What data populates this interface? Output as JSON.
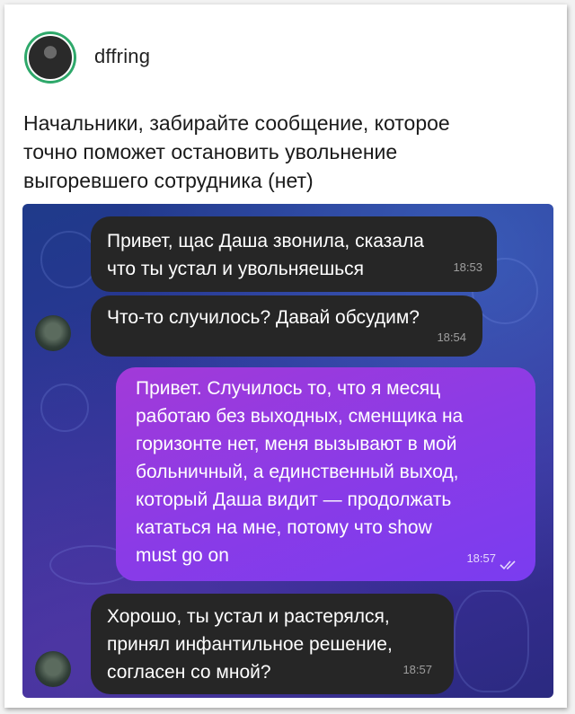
{
  "post": {
    "username": "dffring",
    "text_lines": [
      "Начальники, забирайте сообщение, которое",
      "точно поможет остановить увольнение",
      "выгоревшего сотрудника (нет)"
    ]
  },
  "chat": {
    "messages": [
      {
        "lines": [
          "Привет, щас Даша звонила, сказала",
          "что ты устал и увольняешься"
        ],
        "time": "18:53"
      },
      {
        "lines": [
          "Что-то случилось? Давай обсудим?"
        ],
        "time": "18:54"
      },
      {
        "lines": [
          "Привет. Случилось то, что я месяц",
          "работаю без выходных, сменщика на",
          "горизонте нет, меня вызывают в мой",
          "больничный, а единственный выход,",
          "который Даша видит — продолжать",
          "кататься на мне, потому что show",
          "must go on"
        ],
        "time": "18:57",
        "read_icon": "double-check-icon"
      },
      {
        "lines": [
          "Хорошо, ты устал и растерялся,",
          "принял инфантильное решение,",
          "согласен со мной?"
        ],
        "time": "18:57"
      }
    ]
  }
}
